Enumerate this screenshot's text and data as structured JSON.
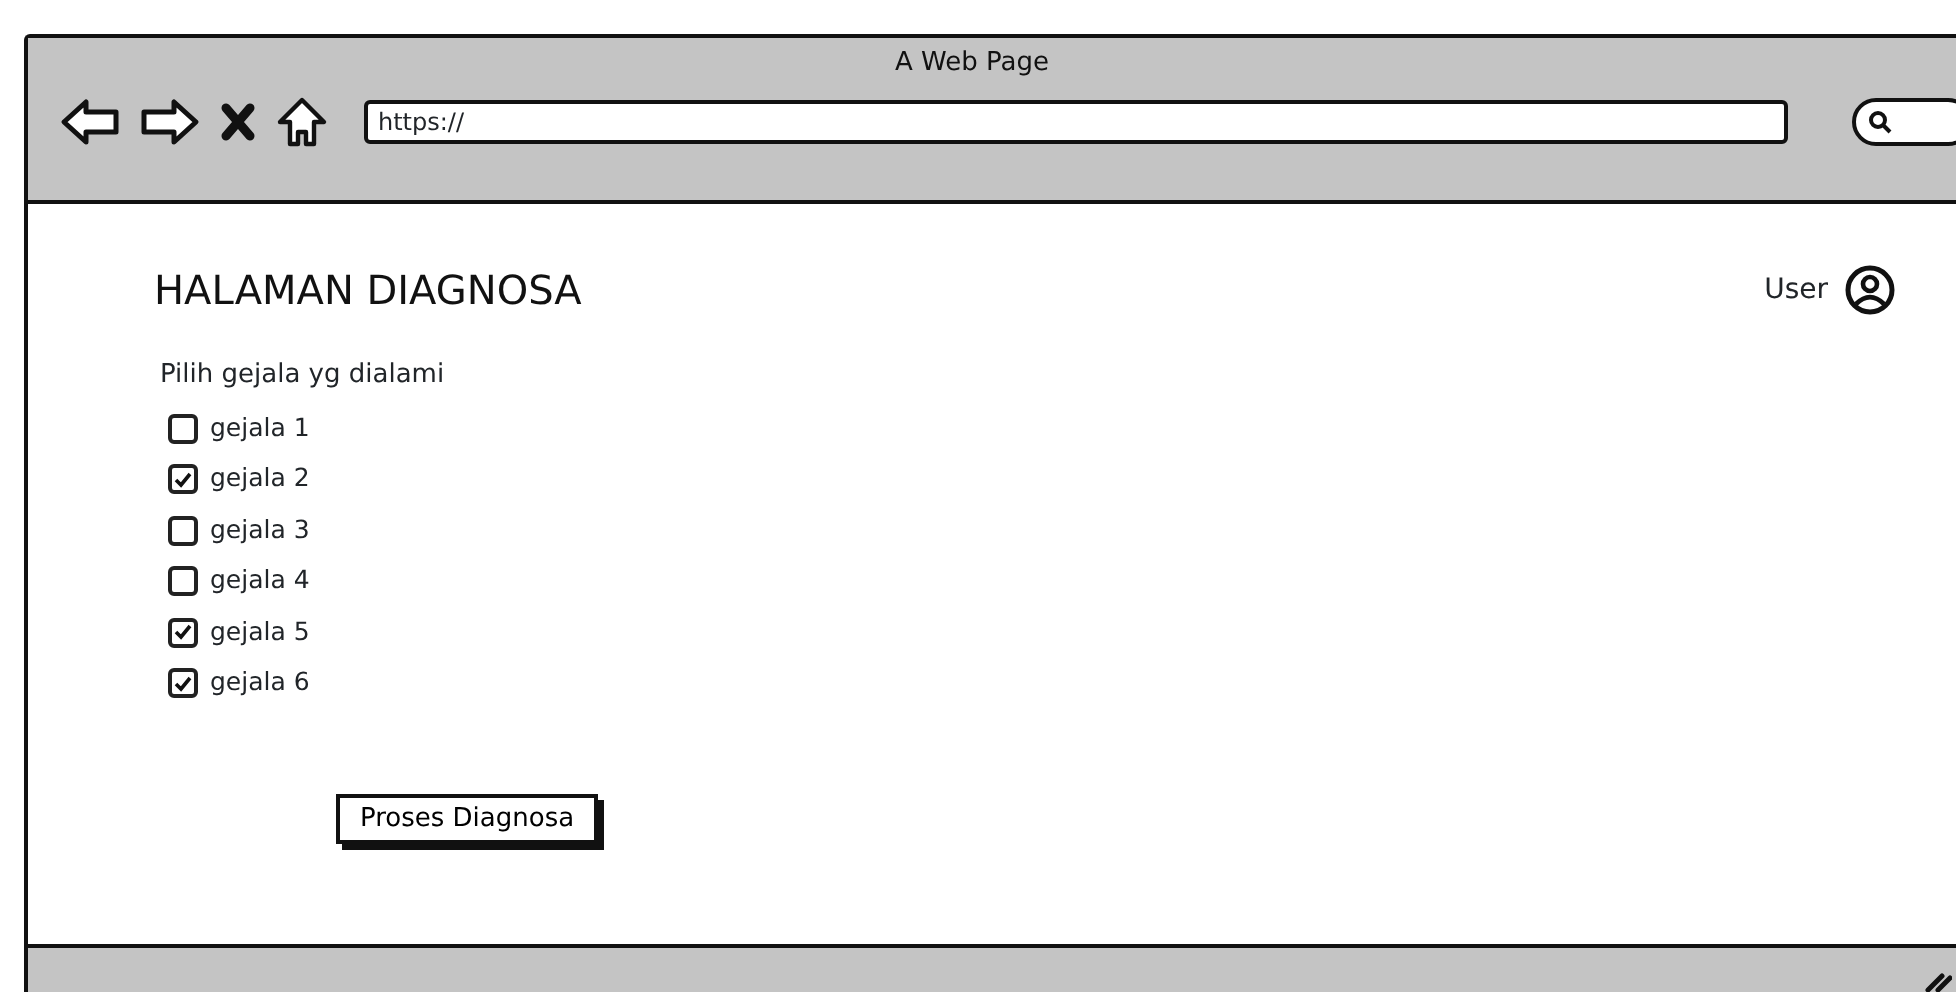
{
  "window": {
    "title": "A Web Page"
  },
  "browser": {
    "address": "https://"
  },
  "page": {
    "heading": "HALAMAN DIAGNOSA",
    "user_label": "User",
    "prompt": "Pilih gejala yg dialami",
    "symptoms": [
      {
        "label": "gejala 1",
        "checked": false
      },
      {
        "label": "gejala 2",
        "checked": true
      },
      {
        "label": "gejala 3",
        "checked": false
      },
      {
        "label": "gejala 4",
        "checked": false
      },
      {
        "label": "gejala 5",
        "checked": true
      },
      {
        "label": "gejala 6",
        "checked": true
      }
    ],
    "button": "Proses Diagnosa"
  }
}
